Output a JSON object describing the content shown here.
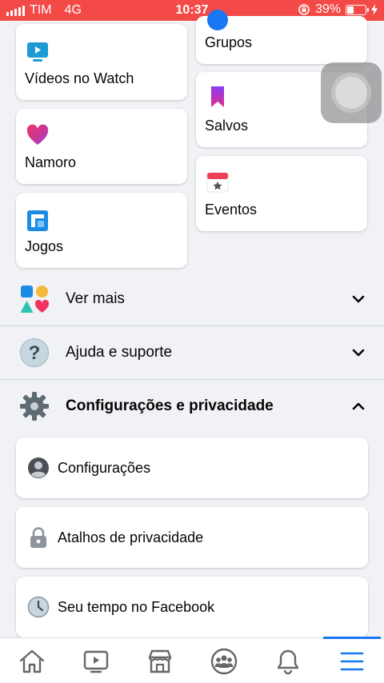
{
  "status_bar": {
    "carrier": "TIM",
    "network": "4G",
    "time": "10:37",
    "battery": "39%",
    "color": "#f44a47"
  },
  "shortcuts": {
    "watch": "Vídeos no Watch",
    "dating": "Namoro",
    "games": "Jogos",
    "groups": "Grupos",
    "saved": "Salvos",
    "events": "Eventos"
  },
  "sections": {
    "see_more": "Ver mais",
    "help": "Ajuda e suporte",
    "settings_privacy": "Configurações e privacidade"
  },
  "settings_items": [
    "Configurações",
    "Atalhos de privacidade",
    "Seu tempo no Facebook"
  ],
  "nav": {
    "items": [
      "home-icon",
      "watch-icon",
      "marketplace-icon",
      "groups-icon",
      "notifications-icon",
      "menu-icon"
    ],
    "active": "menu-icon",
    "accent": "#1877f2"
  }
}
